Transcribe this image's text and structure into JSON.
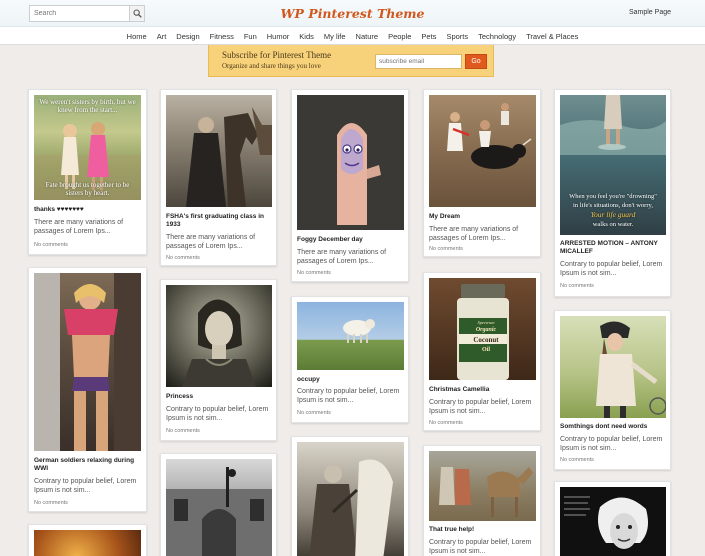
{
  "header": {
    "search_placeholder": "Search",
    "site_title": "WP Pinterest Theme",
    "sample_page": "Sample Page"
  },
  "nav": {
    "items": [
      "Home",
      "Art",
      "Design",
      "Fitness",
      "Fun",
      "Humor",
      "Kids",
      "My life",
      "Nature",
      "People",
      "Pets",
      "Sports",
      "Technology",
      "Travel & Places"
    ]
  },
  "subscribe": {
    "title": "Subscribe for Pinterest Theme",
    "tagline": "Organize and share things you love",
    "email_placeholder": "subscribe email",
    "go_label": "Go"
  },
  "pins": {
    "sisters": {
      "title": "thanks ♥♥♥♥♥♥♥",
      "excerpt": "There are many variations of passages of Lorem Ips...",
      "comments": "No comments",
      "overlay_top": "We weren't sisters by birth, but we knew from the start...",
      "overlay_bottom": "Fate brought us together to be sisters by heart."
    },
    "horse": {
      "title": "FSHA's first graduating class in 1933",
      "excerpt": "There are many variations of passages of Lorem Ips...",
      "comments": "No comments"
    },
    "finger": {
      "title": "Foggy December day",
      "excerpt": "There are many variations of passages of Lorem Ips...",
      "comments": "No comments"
    },
    "bull": {
      "title": "My Dream",
      "excerpt": "There are many variations of passages of Lorem Ips...",
      "comments": "No comments"
    },
    "water": {
      "title": "ARRESTED MOTION – ANTONY MICALLEF",
      "excerpt": "Contrary to popular belief, Lorem Ipsum is not sim...",
      "comments": "No comments",
      "overlay_1": "When you feel you're \"drowning\"",
      "overlay_2": "in life's situations, don't worry,",
      "overlay_3": "Your life guard",
      "overlay_4": "walks on water."
    },
    "fitness": {
      "title": "German soldiers relaxing during WWI",
      "excerpt": "Contrary to popular belief, Lorem Ipsum is not sim...",
      "comments": "No comments"
    },
    "princess": {
      "title": "Princess",
      "excerpt": "Contrary to popular belief, Lorem Ipsum is not sim...",
      "comments": "No comments"
    },
    "lamb": {
      "title": "occupy",
      "excerpt": "Contrary to popular belief, Lorem Ipsum is not sim...",
      "comments": "No comments"
    },
    "coconut": {
      "title": "Christmas Camellia",
      "excerpt": "Contrary to popular belief, Lorem Ipsum is not sim...",
      "comments": "No comments",
      "label_1": "Spectrum",
      "label_2": "Organic",
      "label_3": "Coconut",
      "label_4": "Oil"
    },
    "girl": {
      "title": "Somthings dont need words",
      "excerpt": "Contrary to popular belief, Lorem Ipsum is not sim...",
      "comments": "No comments"
    },
    "camels": {
      "title": "That true help!",
      "excerpt": "Contrary to popular belief, Lorem Ipsum is not sim..."
    }
  },
  "colors": {
    "title_orange": "#d2571c",
    "subscribe_bg": "#f7d27a",
    "go_button": "#e05a1e"
  }
}
